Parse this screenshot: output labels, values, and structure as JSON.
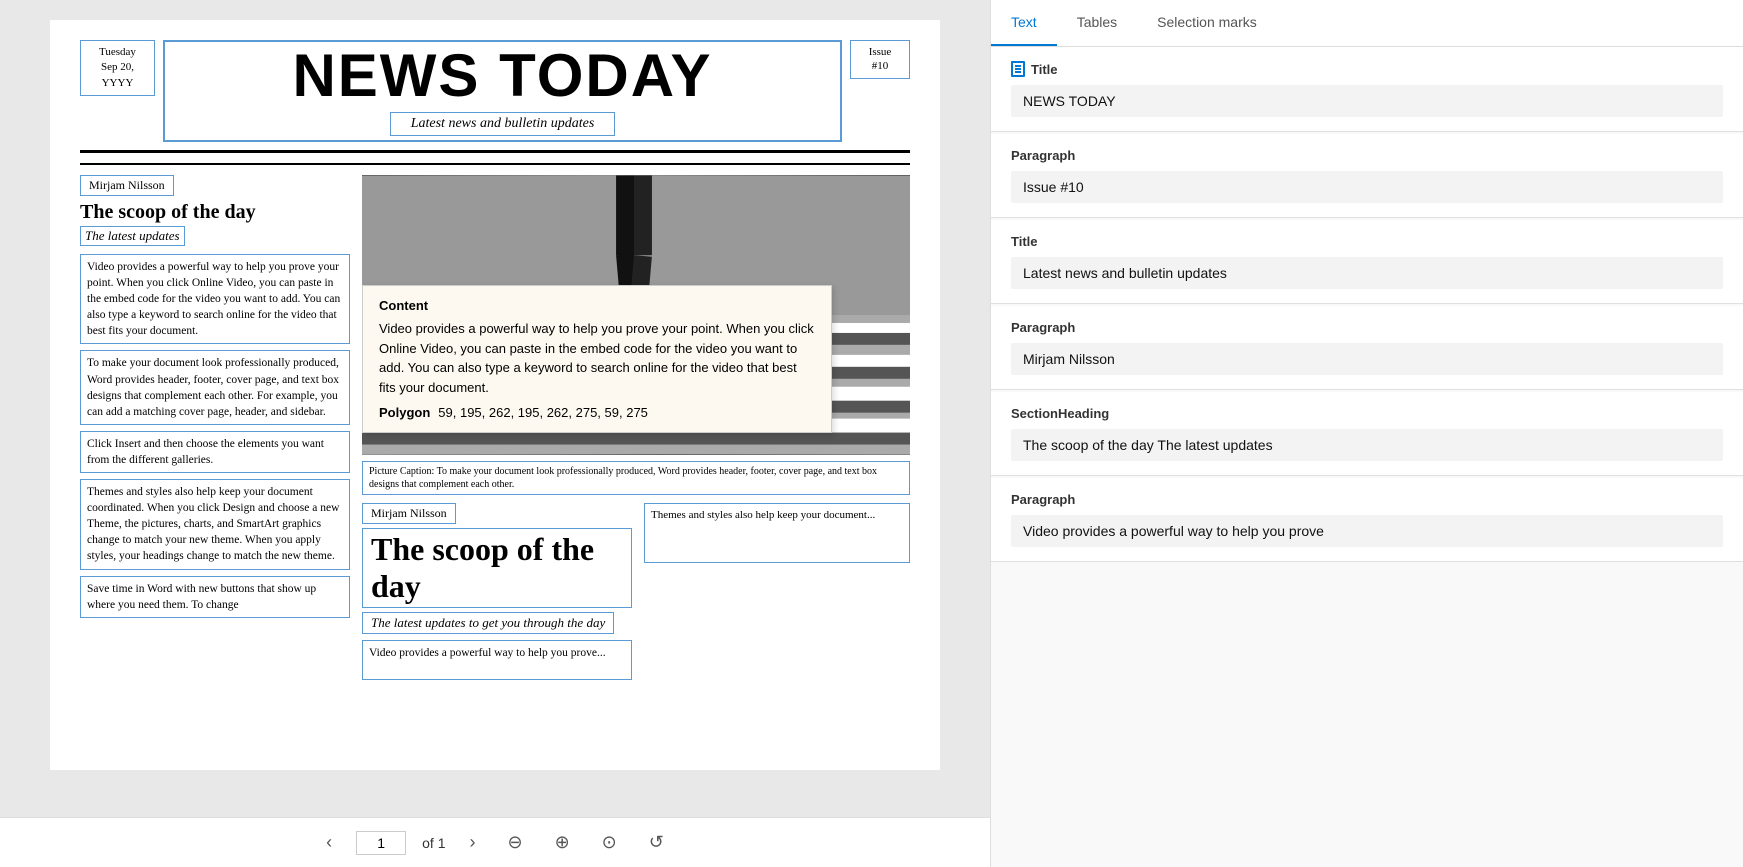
{
  "document": {
    "date": "Tuesday\nSep 20,\nYYYY",
    "title": "NEWS TODAY",
    "subtitle": "Latest news and bulletin updates",
    "issue": "Issue\n#10",
    "author1": "Mirjam Nilsson",
    "heading1": "The scoop of the day",
    "subheading1": "The latest updates",
    "text_block1": "Video provides a powerful way to help you prove your point. When you click Online Video, you can paste in the embed code for the video you want to add. You can also type a keyword to search online for the video that best fits your document.",
    "text_block2": "To make your document look professionally produced, Word provides header, footer, cover page, and text box designs that complement each other. For example, you can add a matching cover page, header, and sidebar.",
    "text_block3": "Click Insert and then choose the elements you want from the different galleries.",
    "text_block4": "Themes and styles also help keep your document coordinated. When you click Design and choose a new Theme, the pictures, charts, and SmartArt graphics change to match your new theme. When you apply styles, your headings change to match the new theme.",
    "text_block5": "Save time in Word with new buttons that show up where you need them. To change",
    "popup_label": "Content",
    "popup_text": "Video provides a powerful way to help you prove your point. When you click Online Video, you can paste in the embed code for the video you want to add. You can also type a keyword to search online for the video that best fits your document.",
    "polygon_label": "Polygon",
    "polygon_values": "59, 195, 262, 195, 262, 275, 59, 275",
    "picture_caption": "Picture Caption: To make your document look professionally produced, Word provides header, footer, cover page, and text box designs that complement each other.",
    "author2": "Mirjam Nilsson",
    "big_heading": "The scoop of the day",
    "latest_updates": "The latest updates to get you through the day",
    "partial_text": "Video provides a powerful way to help you prove...",
    "right_bottom_text": "Themes and styles also help keep your document..."
  },
  "pagination": {
    "current_page": "1",
    "of_label": "of 1"
  },
  "toolbar": {
    "prev_label": "‹",
    "next_label": "›",
    "zoom_out_label": "⊖",
    "zoom_in_label": "⊕",
    "fit_label": "⊙",
    "rotate_label": "↺"
  },
  "right_panel": {
    "tabs": [
      {
        "label": "Text",
        "active": true
      },
      {
        "label": "Tables",
        "active": false
      },
      {
        "label": "Selection marks",
        "active": false
      }
    ],
    "sections": [
      {
        "type": "Title",
        "value": "NEWS TODAY"
      },
      {
        "type": "Paragraph",
        "value": "Issue #10"
      },
      {
        "type": "Title",
        "value": "Latest news and bulletin updates"
      },
      {
        "type": "Paragraph",
        "value": "Mirjam Nilsson"
      },
      {
        "type": "SectionHeading",
        "value": "The scoop of the day The latest updates"
      },
      {
        "type": "Paragraph",
        "value": "Video provides a powerful way to help you prove"
      }
    ]
  }
}
